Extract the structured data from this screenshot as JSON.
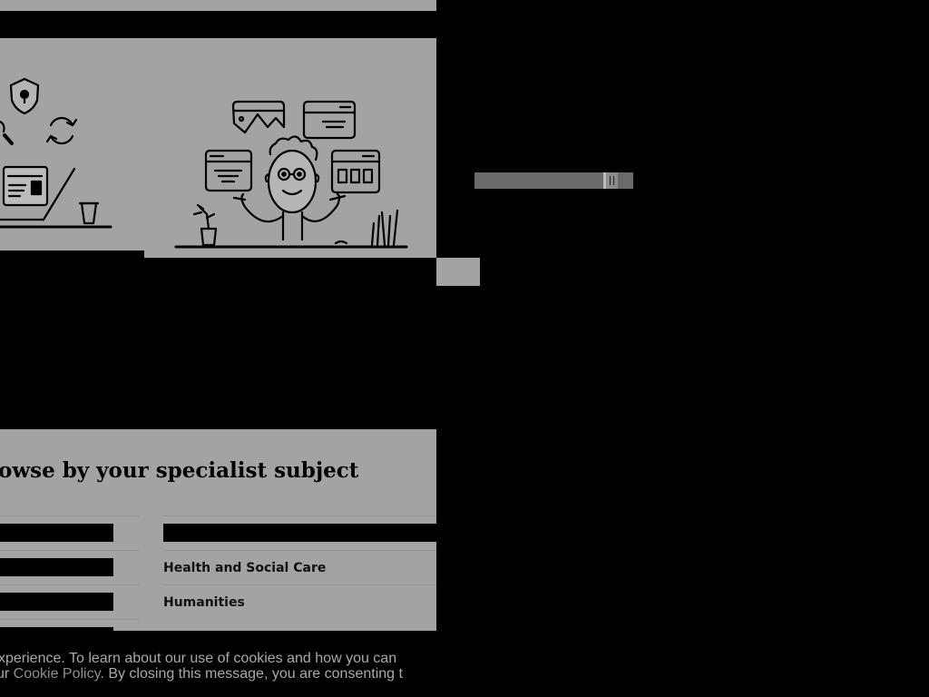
{
  "slider": {
    "value_fraction": 0.89
  },
  "hero": {
    "illustration": "person-with-browser-windows",
    "left_illustration": "laptop-security-sync"
  },
  "subjects_panel": {
    "heading": "owse by your specialist subject",
    "left_column": [
      {
        "label": "",
        "redacted": true
      },
      {
        "label": "",
        "redacted": true
      },
      {
        "label": "",
        "redacted": true
      },
      {
        "label": "",
        "redacted": true
      }
    ],
    "right_column": [
      {
        "label": "",
        "redacted": true
      },
      {
        "label": "Health and Social Care",
        "redacted": false
      },
      {
        "label": "Humanities",
        "redacted": false
      }
    ]
  },
  "cookie_notice": {
    "line1": "xperience. To learn about our use of cookies and how you can",
    "line2_prefix": "ur ",
    "link_text": "Cookie Policy",
    "line2_suffix": ". By closing this message, you are consenting t"
  }
}
